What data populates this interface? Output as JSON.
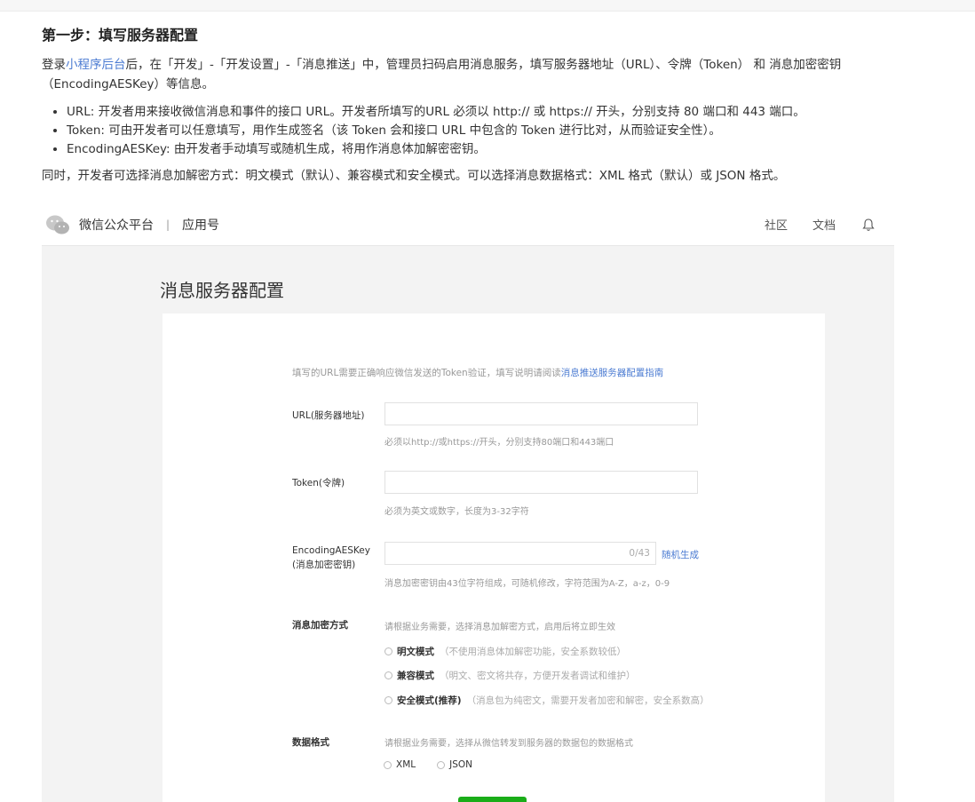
{
  "article": {
    "heading": "第一步：填写服务器配置",
    "intro_prefix": "登录",
    "intro_link": "小程序后台",
    "intro_suffix": "后，在「开发」-「开发设置」-「消息推送」中，管理员扫码启用消息服务，填写服务器地址（URL）、令牌（Token） 和 消息加密密钥（EncodingAESKey）等信息。",
    "bullets": [
      "URL: 开发者用来接收微信消息和事件的接口 URL。开发者所填写的URL 必须以 http:// 或 https:// 开头，分别支持 80 端口和 443 端口。",
      "Token: 可由开发者可以任意填写，用作生成签名（该 Token 会和接口 URL 中包含的 Token 进行比对，从而验证安全性）。",
      "EncodingAESKey: 由开发者手动填写或随机生成，将用作消息体加解密密钥。"
    ],
    "outro": "同时，开发者可选择消息加解密方式：明文模式（默认）、兼容模式和安全模式。可以选择消息数据格式：XML 格式（默认）或 JSON 格式。"
  },
  "topbar": {
    "brand": "微信公众平台",
    "separator": "|",
    "product": "应用号",
    "nav": [
      "社区",
      "文档"
    ],
    "icons": {
      "logo": "wechat-logo-icon",
      "bell": "bell-icon"
    }
  },
  "page": {
    "title": "消息服务器配置",
    "tip_text": "填写的URL需要正确响应微信发送的Token验证，填写说明请阅读",
    "tip_link": "消息推送服务器配置指南"
  },
  "form": {
    "url_label": "URL(服务器地址)",
    "url_hint": "必须以http://或https://开头，分别支持80端口和443端口",
    "token_label": "Token(令牌)",
    "token_hint": "必须为英文或数字，长度为3-32字符",
    "aes_label_1": "EncodingAESKey",
    "aes_label_2": "(消息加密密钥)",
    "aes_counter": "0/43",
    "aes_generate": "随机生成",
    "aes_hint": "消息加密密钥由43位字符组成，可随机修改，字符范围为A-Z，a-z，0-9",
    "encrypt_label": "消息加密方式",
    "encrypt_hint": "请根据业务需要，选择消息加解密方式，启用后将立即生效",
    "encrypt_options": [
      {
        "label": "明文模式",
        "desc": "（不使用消息体加解密功能，安全系数较低）"
      },
      {
        "label": "兼容模式",
        "desc": "（明文、密文将共存，方便开发者调试和维护）"
      },
      {
        "label": "安全模式(推荐)",
        "desc": "（消息包为纯密文，需要开发者加密和解密，安全系数高）"
      }
    ],
    "format_label": "数据格式",
    "format_hint": "请根据业务需要，选择从微信转发到服务器的数据包的数据格式",
    "format_options": [
      "XML",
      "JSON"
    ]
  },
  "colors": {
    "link": "#4b7bd2",
    "primary_button": "#1aad19",
    "content_bg": "#f3f3f3"
  }
}
